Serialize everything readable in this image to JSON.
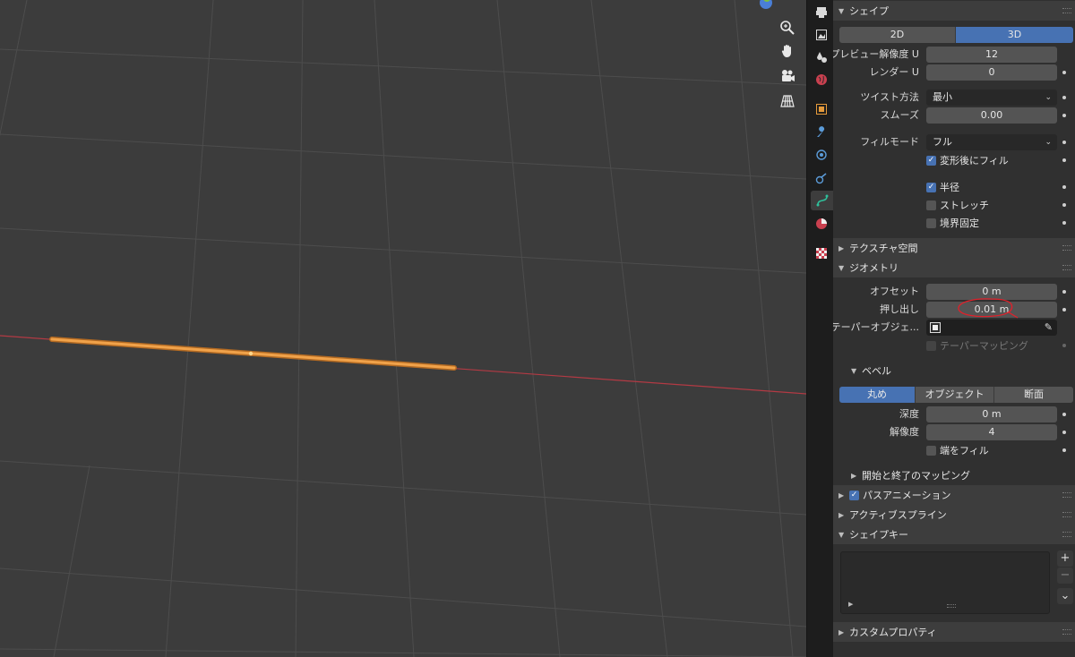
{
  "viewport": {
    "nav_buttons": [
      {
        "icon": "zoom-icon"
      },
      {
        "icon": "pan-hand-icon"
      },
      {
        "icon": "camera-icon"
      },
      {
        "icon": "perspective-grid-icon"
      }
    ],
    "colors": {
      "background": "#3c3c3c",
      "grid": "#4d4d4d",
      "x_axis": "#b33a44",
      "curve": "#f0a24a"
    }
  },
  "tabs": [
    {
      "icon": "render-icon"
    },
    {
      "icon": "output-icon"
    },
    {
      "icon": "view-layer-icon"
    },
    {
      "icon": "world-icon"
    },
    {
      "icon": "object-icon"
    },
    {
      "icon": "modifier-wrench-icon"
    },
    {
      "icon": "particles-icon"
    },
    {
      "icon": "physics-icon"
    },
    {
      "icon": "curve-data-icon",
      "active": true
    },
    {
      "icon": "material-icon"
    },
    {
      "icon": "texture-checker-icon"
    }
  ],
  "shape": {
    "header": "シェイプ",
    "dims": [
      "2D",
      "3D"
    ],
    "dims_selected": "3D",
    "preview_u_label": "プレビュー解像度 U",
    "preview_u_value": "12",
    "render_u_label": "レンダー U",
    "render_u_value": "0",
    "twist_label": "ツイスト方法",
    "twist_value": "最小",
    "smooth_label": "スムーズ",
    "smooth_value": "0.00",
    "fill_label": "フィルモード",
    "fill_value": "フル",
    "fill_deform_label": "変形後にフィル",
    "fill_deform_checked": true,
    "radius_label": "半径",
    "radius_checked": true,
    "stretch_label": "ストレッチ",
    "stretch_checked": false,
    "bounds_label": "境界固定",
    "bounds_checked": false
  },
  "texture_space": {
    "header": "テクスチャ空間"
  },
  "geometry": {
    "header": "ジオメトリ",
    "offset_label": "オフセット",
    "offset_value": "0 m",
    "extrude_label": "押し出し",
    "extrude_value": "0.01 m",
    "taper_label": "テーパーオブジェ...",
    "taper_mapping_label": "テーパーマッピング",
    "bevel": {
      "header": "ベベル",
      "modes": [
        "丸め",
        "オブジェクト",
        "断面"
      ],
      "mode_selected": "丸め",
      "depth_label": "深度",
      "depth_value": "0 m",
      "resolution_label": "解像度",
      "resolution_value": "4",
      "fill_caps_label": "端をフィル",
      "fill_caps_checked": false
    },
    "start_end_header": "開始と終了のマッピング"
  },
  "path_animation": {
    "header": "パスアニメーション",
    "checked": true
  },
  "active_spline": {
    "header": "アクティブスプライン"
  },
  "shape_keys": {
    "header": "シェイプキー",
    "add": "+",
    "remove": "−",
    "more": "⌄"
  },
  "custom_props": {
    "header": "カスタムプロパティ"
  }
}
